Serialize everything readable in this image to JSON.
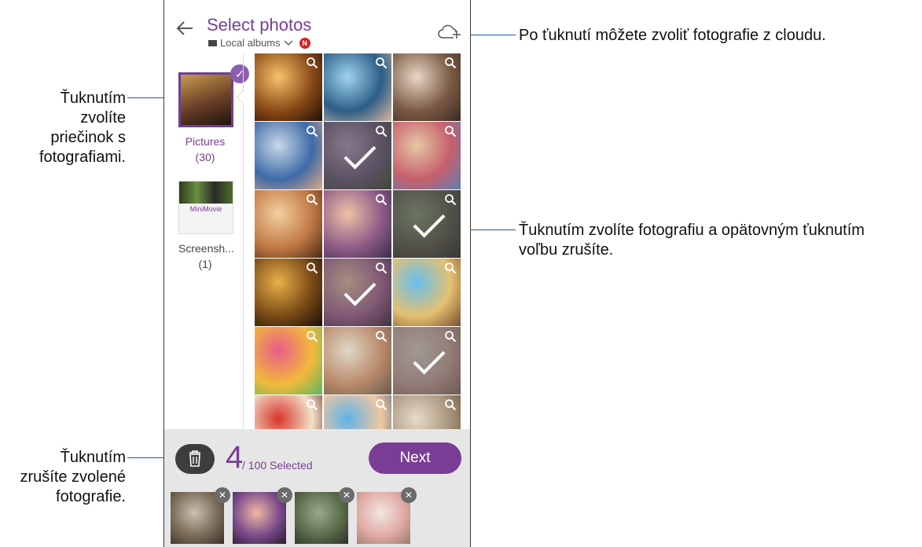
{
  "header": {
    "title": "Select photos",
    "album_label": "Local albums",
    "badge": "N"
  },
  "folders": [
    {
      "name": "Pictures",
      "count": "(30)",
      "selected": true
    },
    {
      "name": "Screensh...",
      "count": "(1)",
      "selected": false,
      "thumb_text": "MiniMovie"
    }
  ],
  "grid": {
    "photos": [
      {
        "id": 1,
        "selected": false,
        "colors": [
          "#f6c26b",
          "#8a4a16",
          "#1d0f07"
        ]
      },
      {
        "id": 2,
        "selected": false,
        "colors": [
          "#9fd4ef",
          "#2c5e86",
          "#d6b9a1"
        ]
      },
      {
        "id": 3,
        "selected": false,
        "colors": [
          "#e8d7c4",
          "#7b5a45",
          "#3a2a22"
        ]
      },
      {
        "id": 4,
        "selected": false,
        "colors": [
          "#c7d9e6",
          "#3e6aa7",
          "#d9a98a"
        ]
      },
      {
        "id": 5,
        "selected": true,
        "colors": [
          "#b9a0c4",
          "#6d5b7a",
          "#3b4a2e"
        ]
      },
      {
        "id": 6,
        "selected": false,
        "colors": [
          "#e5c7a5",
          "#c65f6c",
          "#5f7fb5"
        ]
      },
      {
        "id": 7,
        "selected": false,
        "colors": [
          "#f4cfa0",
          "#c07a45",
          "#4a2816"
        ]
      },
      {
        "id": 8,
        "selected": false,
        "colors": [
          "#f0c2a8",
          "#8e5d87",
          "#3c2a4c"
        ]
      },
      {
        "id": 9,
        "selected": true,
        "colors": [
          "#8a9a7a",
          "#5d5a4a",
          "#2a2a26"
        ]
      },
      {
        "id": 10,
        "selected": false,
        "colors": [
          "#e8b04a",
          "#7a4a16",
          "#1a0e06"
        ]
      },
      {
        "id": 11,
        "selected": true,
        "colors": [
          "#f4c9b0",
          "#b1689a",
          "#3a1f3d"
        ]
      },
      {
        "id": 12,
        "selected": false,
        "colors": [
          "#68c0f0",
          "#e5c070",
          "#7a5030"
        ]
      },
      {
        "id": 13,
        "selected": false,
        "colors": [
          "#e85c8c",
          "#f2b93b",
          "#5cb85c"
        ]
      },
      {
        "id": 14,
        "selected": false,
        "colors": [
          "#e0d8c8",
          "#b98a6a",
          "#6a5a4a"
        ]
      },
      {
        "id": 15,
        "selected": true,
        "colors": [
          "#e8dcd5",
          "#d3a8a0",
          "#8a6a5a"
        ]
      },
      {
        "id": 16,
        "selected": false,
        "colors": [
          "#d8342c",
          "#f2e0c8",
          "#5a1a12"
        ]
      },
      {
        "id": 17,
        "selected": false,
        "colors": [
          "#5fb3e8",
          "#f0c7a0",
          "#3a5a80"
        ]
      },
      {
        "id": 18,
        "selected": false,
        "colors": [
          "#e6dccb",
          "#a9927a",
          "#5a4a3a"
        ]
      }
    ]
  },
  "selection": {
    "count": "4",
    "label": "/ 100 Selected",
    "next_label": "Next",
    "selected_thumbs": [
      {
        "colors": [
          "#c9c0ae",
          "#7a6a58",
          "#3a3026"
        ]
      },
      {
        "colors": [
          "#f0b9a5",
          "#7a4a8a",
          "#2a1a30"
        ]
      },
      {
        "colors": [
          "#9aa98a",
          "#5a6a4a",
          "#2a3024"
        ]
      },
      {
        "colors": [
          "#f1e6e0",
          "#e0aaa5",
          "#9a7a6a"
        ]
      }
    ]
  },
  "callouts": {
    "cloud": "Po ťuknutí môžete zvoliť fotografie z cloudu.",
    "folder": [
      "Ťuknutím",
      "zvolíte",
      "priečinok s",
      "fotografiami."
    ],
    "photo": [
      "Ťuknutím zvolíte fotografiu a opätovným ťuknutím",
      "voľbu zrušíte."
    ],
    "delete": [
      "Ťuknutím",
      "zrušíte zvolené",
      "fotografie."
    ]
  },
  "colors": {
    "accent": "#7a3d96",
    "leader": "#1e5aa8"
  }
}
